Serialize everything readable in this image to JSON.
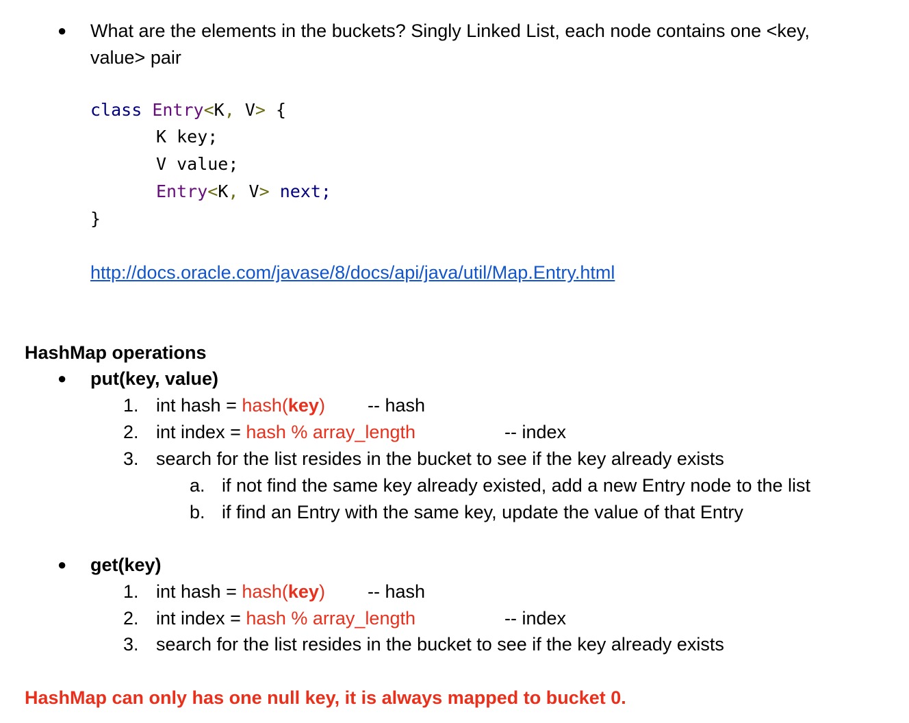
{
  "bullet_symbol": "●",
  "intro": {
    "line1": "What are the elements in the buckets? Singly Linked List, each node contains one <key,",
    "line2": "value> pair"
  },
  "code": {
    "l1_kw": "class",
    "l1_type": "Entry",
    "lt": "<",
    "gt": ">",
    "comma": ",",
    "k": "K",
    "v": "V",
    "l1_brace": "{",
    "l2": "K key;",
    "l3": "V value;",
    "l4_next": "next;",
    "l5": "}"
  },
  "link": "http://docs.oracle.com/javase/8/docs/api/java/util/Map.Entry.html",
  "heading": "HashMap operations",
  "put": {
    "title": "put(key, value)",
    "steps": [
      {
        "num": "1.",
        "pre": "int hash = ",
        "red": "hash(",
        "red_bold": "key",
        "red_end": ")",
        "comment": "-- hash"
      },
      {
        "num": "2.",
        "pre": "int index = ",
        "red": "hash % array_length",
        "comment": "-- index"
      },
      {
        "num": "3.",
        "text": "search for the list resides in the bucket to see if the key already exists"
      }
    ],
    "substeps": [
      {
        "label": "a.",
        "text": "if not find the same key already existed, add a new Entry node to the list"
      },
      {
        "label": "b.",
        "text": "if find an Entry with the same key, update the value of that Entry"
      }
    ]
  },
  "get": {
    "title": "get(key)",
    "steps": [
      {
        "num": "1.",
        "pre": "int hash = ",
        "red": "hash(",
        "red_bold": "key",
        "red_end": ")",
        "comment": "-- hash"
      },
      {
        "num": "2.",
        "pre": "int index = ",
        "red": "hash % array_length",
        "comment": "-- index"
      },
      {
        "num": "3.",
        "text": "search for the list resides in the bucket to see if the key already exists"
      }
    ]
  },
  "note": "HashMap can only has one null key, it is always mapped to bucket 0.",
  "colors": {
    "red": "#e8301c",
    "keyword": "#000080",
    "type": "#660e7a",
    "link": "#1155cc"
  }
}
